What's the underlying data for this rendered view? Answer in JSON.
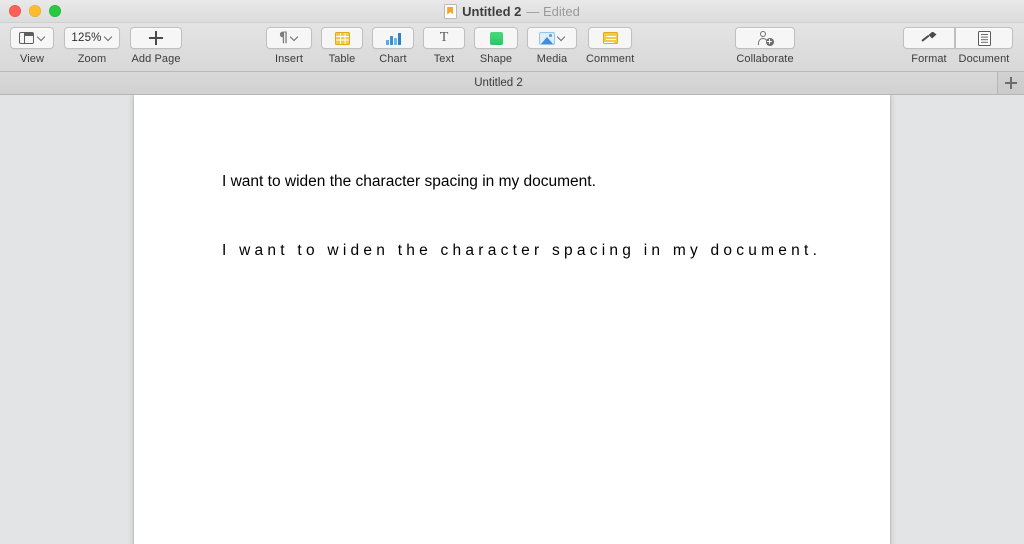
{
  "window": {
    "title": "Untitled 2",
    "title_status": "— Edited",
    "doc_icon": "pages-document-icon",
    "traffic_lights": {
      "close": "#ff5f57",
      "minimize": "#febc2e",
      "zoom": "#28c840"
    }
  },
  "toolbar": {
    "left_group": [
      {
        "label": "View",
        "icon": "layout-view-icon",
        "chevron": true,
        "value": ""
      },
      {
        "label": "Zoom",
        "icon": "zoom-level-icon",
        "chevron": true,
        "value": "125%"
      },
      {
        "label": "Add Page",
        "icon": "plus-icon",
        "chevron": false,
        "value": ""
      }
    ],
    "center_group": [
      {
        "label": "Insert",
        "icon": "pilcrow-icon",
        "chevron": true
      },
      {
        "label": "Table",
        "icon": "table-icon",
        "chevron": false
      },
      {
        "label": "Chart",
        "icon": "bar-chart-icon",
        "chevron": false
      },
      {
        "label": "Text",
        "icon": "text-t-icon",
        "chevron": false
      },
      {
        "label": "Shape",
        "icon": "green-square-shape-icon",
        "chevron": false
      },
      {
        "label": "Media",
        "icon": "photo-icon",
        "chevron": true
      },
      {
        "label": "Comment",
        "icon": "comment-note-icon",
        "chevron": false
      }
    ],
    "collaborate": {
      "label": "Collaborate",
      "icon": "person-add-icon"
    },
    "right_group": [
      {
        "label": "Format",
        "icon": "paintbrush-icon"
      },
      {
        "label": "Document",
        "icon": "document-page-icon"
      }
    ]
  },
  "tabbar": {
    "tabs": [
      {
        "label": "Untitled 2",
        "active": true
      }
    ],
    "new_tab_icon": "plus-icon"
  },
  "document": {
    "lines": [
      {
        "text": "I want to widen the character spacing in my document.",
        "spacing": "normal"
      },
      {
        "text": "I want to widen the character spacing in my document.",
        "spacing": "widened"
      }
    ]
  },
  "colors": {
    "toolbar_bg": "#dedede",
    "canvas_bg": "#e3e4e6",
    "page_bg": "#ffffff",
    "text": "#000000",
    "accent_yellow": "#f7c948",
    "accent_blue": "#3d8fd1",
    "accent_green": "#2ec464"
  }
}
